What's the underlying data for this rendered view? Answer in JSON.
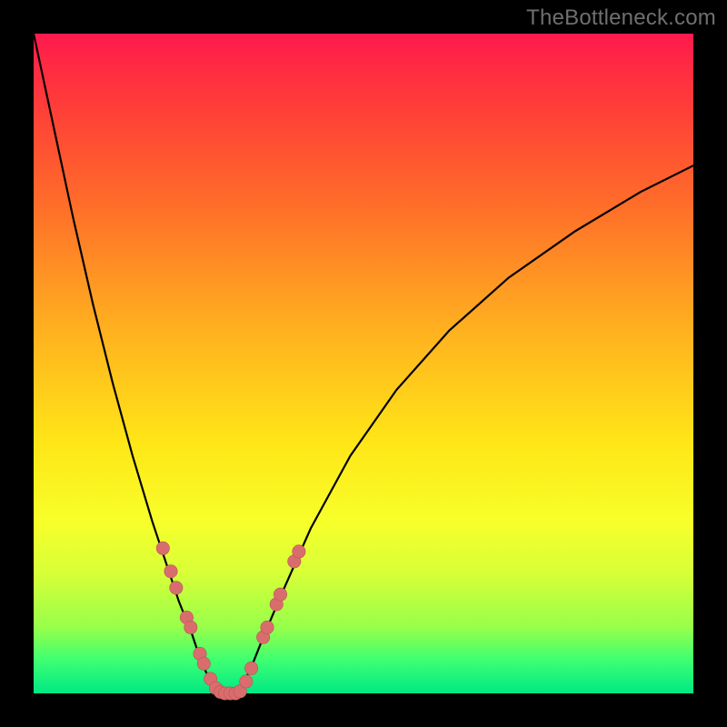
{
  "watermark": "TheBottleneck.com",
  "colors": {
    "bead_fill": "#d96d6d",
    "bead_stroke": "#b95555",
    "curve": "#000000",
    "gradient_top": "#ff1a4d",
    "gradient_bottom": "#00e884"
  },
  "chart_data": {
    "type": "line",
    "title": "",
    "xlabel": "",
    "ylabel": "",
    "xlim": [
      0,
      100
    ],
    "ylim": [
      0,
      100
    ],
    "note": "Bottleneck-style V curve. y ≈ 0 at the valley (x≈27–31), rising steeply on both sides. Axes are unlabeled; values are read off pixel geometry as percentages of the plot area.",
    "series": [
      {
        "name": "left-branch",
        "x": [
          0,
          3,
          6,
          9,
          12,
          15,
          18,
          20,
          22,
          24,
          25,
          26,
          27,
          28
        ],
        "y": [
          100,
          86,
          72,
          59,
          47,
          36,
          26,
          20,
          14,
          9,
          6,
          3.5,
          1.5,
          0
        ]
      },
      {
        "name": "valley",
        "x": [
          28,
          29,
          30,
          31
        ],
        "y": [
          0,
          0,
          0,
          0
        ]
      },
      {
        "name": "right-branch",
        "x": [
          31,
          33,
          35,
          38,
          42,
          48,
          55,
          63,
          72,
          82,
          92,
          100
        ],
        "y": [
          0,
          4,
          9,
          16,
          25,
          36,
          46,
          55,
          63,
          70,
          76,
          80
        ]
      }
    ],
    "markers": {
      "name": "beads",
      "note": "Salmon-colored dotted markers clustered near valley on both branches and along the flat bottom.",
      "points": [
        {
          "x": 19.6,
          "y": 22.0
        },
        {
          "x": 20.8,
          "y": 18.5
        },
        {
          "x": 21.6,
          "y": 16.0
        },
        {
          "x": 23.2,
          "y": 11.5
        },
        {
          "x": 23.8,
          "y": 10.0
        },
        {
          "x": 25.2,
          "y": 6.0
        },
        {
          "x": 25.8,
          "y": 4.5
        },
        {
          "x": 26.8,
          "y": 2.2
        },
        {
          "x": 27.6,
          "y": 0.8
        },
        {
          "x": 28.3,
          "y": 0.2
        },
        {
          "x": 29.0,
          "y": 0.0
        },
        {
          "x": 29.8,
          "y": 0.0
        },
        {
          "x": 30.6,
          "y": 0.0
        },
        {
          "x": 31.3,
          "y": 0.3
        },
        {
          "x": 32.2,
          "y": 1.8
        },
        {
          "x": 33.0,
          "y": 3.8
        },
        {
          "x": 34.8,
          "y": 8.5
        },
        {
          "x": 35.4,
          "y": 10.0
        },
        {
          "x": 36.8,
          "y": 13.5
        },
        {
          "x": 37.4,
          "y": 15.0
        },
        {
          "x": 39.5,
          "y": 20.0
        },
        {
          "x": 40.2,
          "y": 21.5
        }
      ]
    }
  }
}
